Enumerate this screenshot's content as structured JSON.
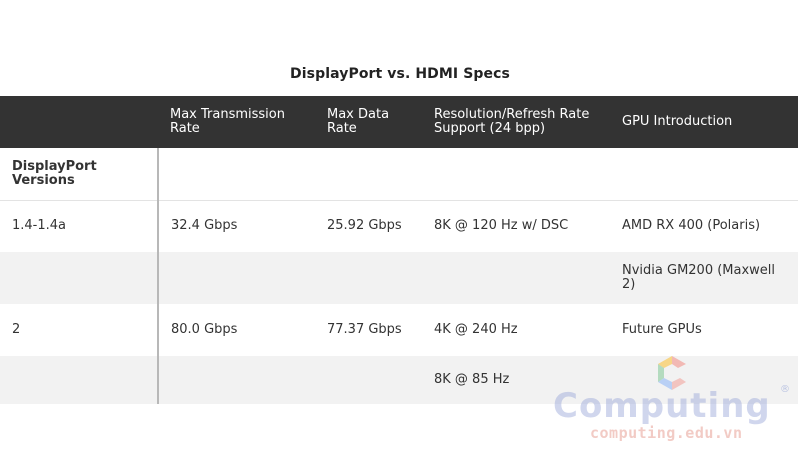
{
  "title": "DisplayPort vs. HDMI Specs",
  "table": {
    "headers": [
      "",
      "Max Transmission Rate",
      "Max Data Rate",
      "Resolution/Refresh Rate Support (24 bpp)",
      "GPU Introduction"
    ],
    "section_label": "DisplayPort Versions",
    "rows": [
      [
        "1.4-1.4a",
        "32.4 Gbps",
        "25.92 Gbps",
        "8K @ 120 Hz w/ DSC",
        "AMD RX 400 (Polaris)"
      ],
      [
        "",
        "",
        "",
        "",
        "Nvidia GM200 (Maxwell 2)"
      ],
      [
        "2",
        "80.0 Gbps",
        "77.37 Gbps",
        "4K @ 240 Hz",
        "Future GPUs"
      ],
      [
        "",
        "",
        "",
        "8K @ 85 Hz",
        ""
      ]
    ]
  },
  "watermark": {
    "brand": "Computing",
    "registered": "®",
    "url": "computing.edu.vn",
    "logo_colors": [
      "#f28b82",
      "#fbc02d",
      "#81c995",
      "#8ab4f8"
    ]
  }
}
